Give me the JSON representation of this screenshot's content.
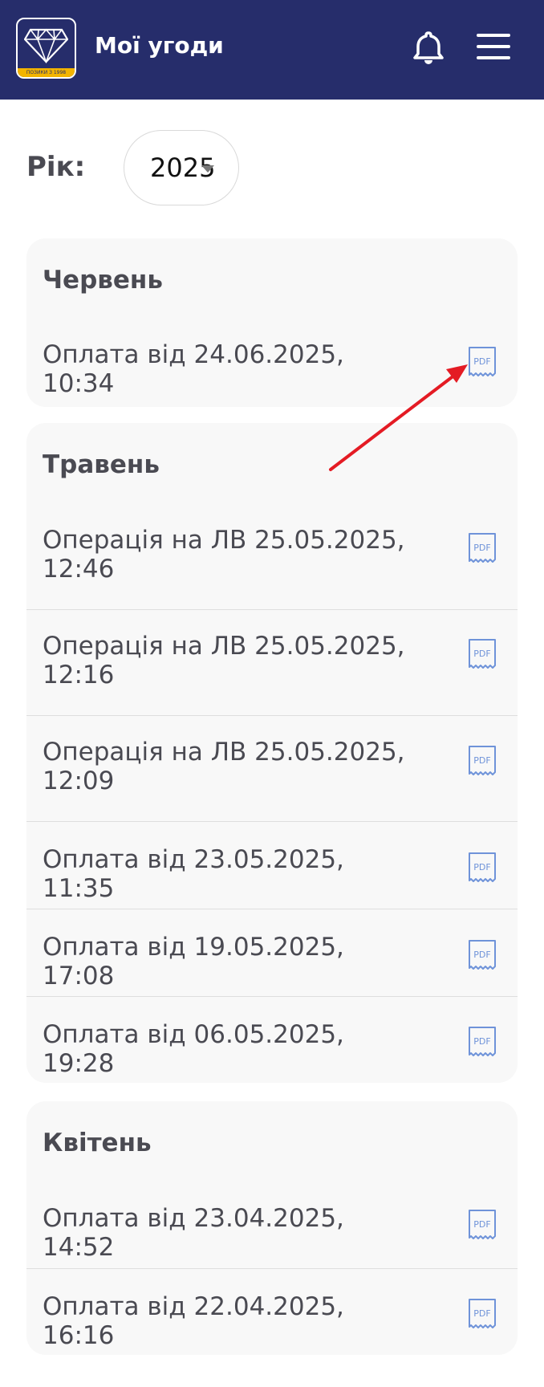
{
  "header": {
    "title": "Мої угоди",
    "logo_caption": "ПОЗИКИ З 1998",
    "icons": [
      "diamond-logo-icon",
      "bell-icon",
      "menu-icon"
    ]
  },
  "filter": {
    "year_label": "Рік:",
    "year_value": "2025"
  },
  "sections": [
    {
      "month": "Червень",
      "items": [
        "Оплата від 24.06.2025, 10:34"
      ]
    },
    {
      "month": "Травень",
      "items": [
        "Операція на ЛВ 25.05.2025, 12:46",
        "Операція на ЛВ 25.05.2025, 12:16",
        "Операція на ЛВ 25.05.2025, 12:09",
        "Оплата від 23.05.2025, 11:35",
        "Оплата від 19.05.2025, 17:08",
        "Оплата від 06.05.2025, 19:28"
      ]
    },
    {
      "month": "Квітень",
      "items": [
        "Оплата від 23.04.2025, 14:52",
        "Оплата від 22.04.2025, 16:16"
      ]
    }
  ],
  "pdf_label": "PDF",
  "colors": {
    "header_bg": "#262d6b",
    "logo_band": "#f3b400",
    "pdf_icon": "#6f93d9",
    "annotation_arrow": "#e41b24"
  }
}
